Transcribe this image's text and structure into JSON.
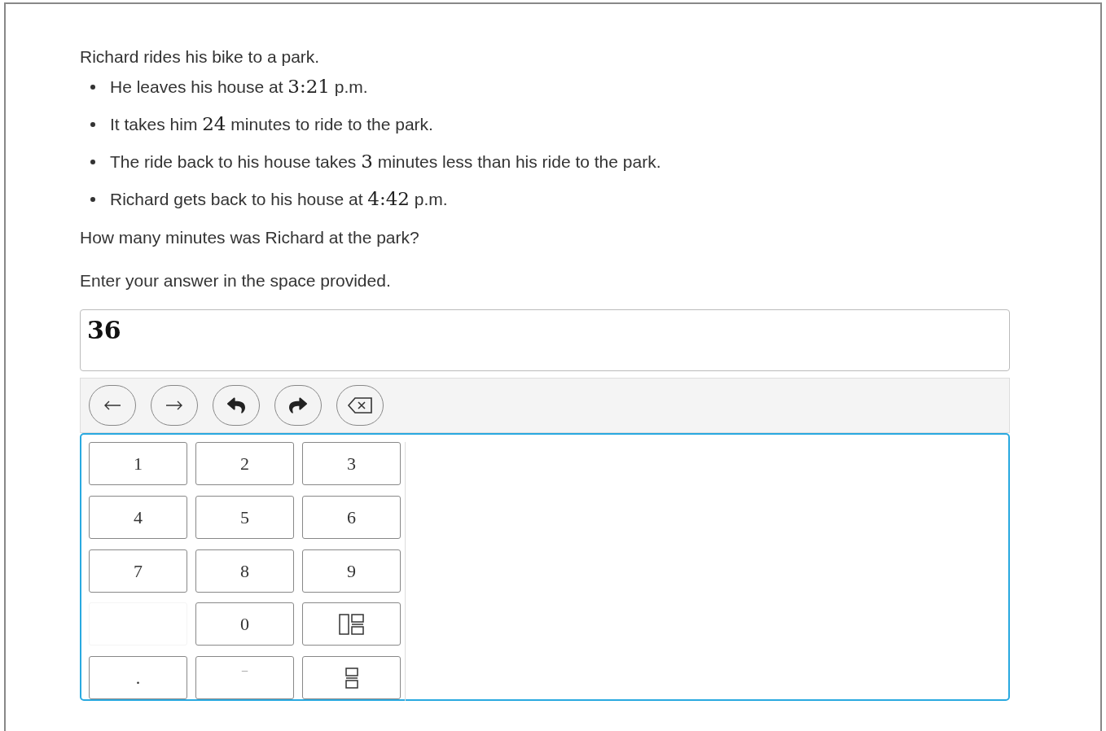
{
  "question": {
    "intro": "Richard rides his bike to a park.",
    "bullets": [
      [
        {
          "kind": "text",
          "text": "He leaves his house at "
        },
        {
          "kind": "math",
          "text": "3:21"
        },
        {
          "kind": "text",
          "text": " p.m."
        }
      ],
      [
        {
          "kind": "text",
          "text": "It takes him "
        },
        {
          "kind": "math",
          "text": "24"
        },
        {
          "kind": "text",
          "text": " minutes to ride to the park."
        }
      ],
      [
        {
          "kind": "text",
          "text": "The ride back to his house takes "
        },
        {
          "kind": "math",
          "text": "3"
        },
        {
          "kind": "text",
          "text": " minutes less than his ride to the park."
        }
      ],
      [
        {
          "kind": "text",
          "text": "Richard gets back to his house at "
        },
        {
          "kind": "math",
          "text": "4:42"
        },
        {
          "kind": "text",
          "text": " p.m."
        }
      ]
    ],
    "prompt": "How many minutes was Richard at the park?",
    "instruction": "Enter your answer in the space provided."
  },
  "answer": {
    "value": "36"
  },
  "toolbar": [
    {
      "kind": "left"
    },
    {
      "kind": "right"
    },
    {
      "kind": "undo"
    },
    {
      "kind": "redo"
    },
    {
      "kind": "backspace"
    }
  ],
  "keypad": [
    {
      "kind": "key",
      "label": "1"
    },
    {
      "kind": "key",
      "label": "2"
    },
    {
      "kind": "key",
      "label": "3"
    },
    {
      "kind": "key",
      "label": "4"
    },
    {
      "kind": "key",
      "label": "5"
    },
    {
      "kind": "key",
      "label": "6"
    },
    {
      "kind": "key",
      "label": "7"
    },
    {
      "kind": "key",
      "label": "8"
    },
    {
      "kind": "key",
      "label": "9"
    },
    {
      "kind": "empty"
    },
    {
      "kind": "key",
      "label": "0"
    },
    {
      "kind": "mixed-number"
    },
    {
      "kind": "key",
      "label": "."
    },
    {
      "kind": "minus",
      "label": "−"
    },
    {
      "kind": "fraction"
    }
  ]
}
